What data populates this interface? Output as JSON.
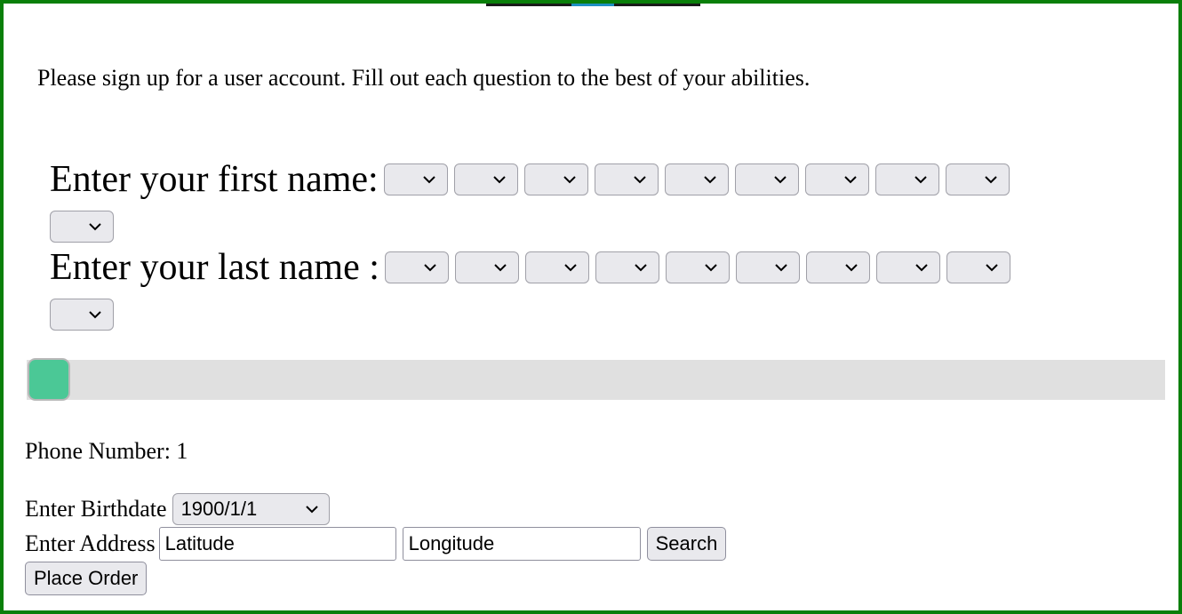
{
  "intro_text": "Please sign up for a user account. Fill out each question to the best of your abilities.",
  "first_name": {
    "label": "Enter your first name:",
    "selects": 10
  },
  "last_name": {
    "label": "Enter your last name :",
    "selects": 10
  },
  "slider": {
    "value": 1,
    "min": 1,
    "max": 100,
    "thumb_color": "#4bc896",
    "track_color": "#e0e0e0"
  },
  "phone": {
    "label": "Phone Number: ",
    "value": "1"
  },
  "birthdate": {
    "label": "Enter Birthdate",
    "value": "1900/1/1"
  },
  "address": {
    "label": "Enter Address",
    "latitude_value": "Latitude",
    "longitude_value": "Longitude",
    "search_label": "Search"
  },
  "order": {
    "label": "Place Order"
  },
  "colors": {
    "frame_border": "#0a7f0a",
    "accent": "#1f8fc1"
  }
}
